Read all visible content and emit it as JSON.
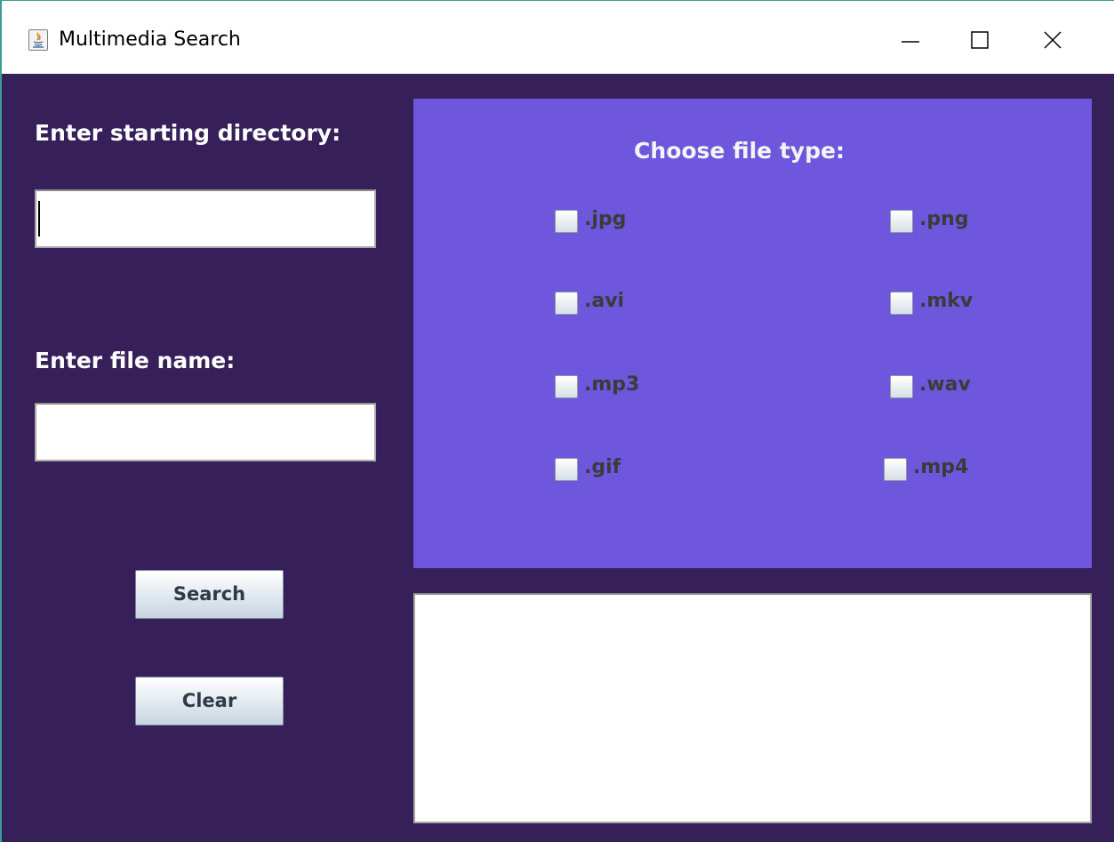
{
  "window": {
    "title": "Multimedia Search",
    "icon": "java-icon",
    "controls": {
      "minimize": "minimize-icon",
      "maximize": "maximize-icon",
      "close": "close-icon"
    }
  },
  "form": {
    "directory_label": "Enter starting directory:",
    "directory_value": "",
    "file_name_label": "Enter file name:",
    "file_name_value": "",
    "search_button": "Search",
    "clear_button": "Clear"
  },
  "file_types": {
    "title": "Choose file type:",
    "options": [
      {
        "label": ".jpg",
        "checked": false
      },
      {
        "label": ".png",
        "checked": false
      },
      {
        "label": ".avi",
        "checked": false
      },
      {
        "label": ".mkv",
        "checked": false
      },
      {
        "label": ".mp3",
        "checked": false
      },
      {
        "label": ".wav",
        "checked": false
      },
      {
        "label": ".gif",
        "checked": false
      },
      {
        "label": ".mp4",
        "checked": false
      }
    ]
  },
  "results": {
    "text": ""
  },
  "colors": {
    "background": "#37205a",
    "panel": "#6e57dc",
    "label_text": "#ffffff",
    "checkbox_text": "#3b3b3b"
  }
}
